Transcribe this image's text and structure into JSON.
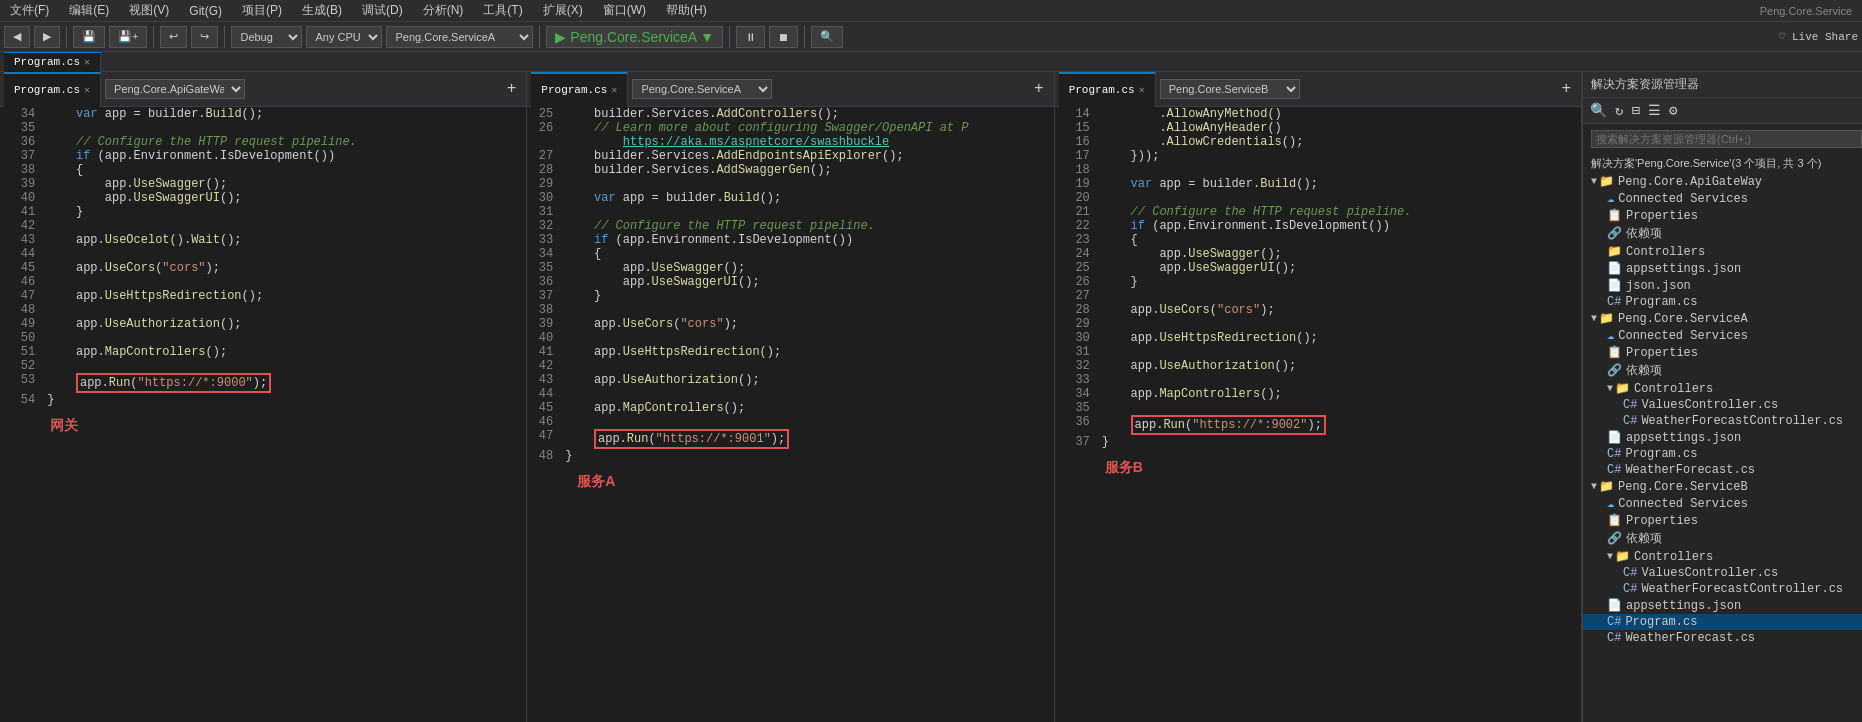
{
  "menubar": {
    "items": [
      "文件(F)",
      "编辑(E)",
      "视图(V)",
      "Git(G)",
      "项目(P)",
      "生成(B)",
      "调试(D)",
      "分析(N)",
      "工具(T)",
      "扩展(X)",
      "窗口(W)",
      "帮助(H)"
    ]
  },
  "toolbar": {
    "back_btn": "◀",
    "forward_btn": "▶",
    "debug_mode": "Debug",
    "platform": "Any CPU",
    "project": "Peng.Core.ServiceA",
    "play_label": "▶ Peng.Core.ServiceA ▼",
    "live_share": "♡ Live Share"
  },
  "top_tabs": [
    {
      "label": "Program.cs",
      "active": true,
      "closeable": true
    }
  ],
  "panels": [
    {
      "id": "panel1",
      "tab_label": "Program.cs",
      "dropdown_label": "Peng.Core.ApiGateWa...",
      "title": "网关",
      "lines": [
        {
          "num": 34,
          "code": "    var app = builder.Build();"
        },
        {
          "num": 35,
          "code": ""
        },
        {
          "num": 36,
          "code": "    // Configure the HTTP request pipeline."
        },
        {
          "num": 37,
          "code": "    if (app.Environment.IsDevelopment())"
        },
        {
          "num": 38,
          "code": "    {"
        },
        {
          "num": 39,
          "code": "        app.UseSwagger();"
        },
        {
          "num": 40,
          "code": "        app.UseSwaggerUI();"
        },
        {
          "num": 41,
          "code": "    }"
        },
        {
          "num": 42,
          "code": ""
        },
        {
          "num": 43,
          "code": "    app.UseOcelot().Wait();"
        },
        {
          "num": 44,
          "code": ""
        },
        {
          "num": 45,
          "code": "    app.UseCors(\"cors\");"
        },
        {
          "num": 46,
          "code": ""
        },
        {
          "num": 47,
          "code": "    app.UseHttpsRedirection();"
        },
        {
          "num": 48,
          "code": ""
        },
        {
          "num": 49,
          "code": "    app.UseAuthorization();"
        },
        {
          "num": 50,
          "code": ""
        },
        {
          "num": 51,
          "code": "    app.MapControllers();"
        },
        {
          "num": 52,
          "code": ""
        },
        {
          "num": 53,
          "code": "    app.Run(\"https://*:9000\");",
          "highlight": true
        },
        {
          "num": 54,
          "code": "}"
        }
      ]
    },
    {
      "id": "panel2",
      "tab_label": "Program.cs",
      "dropdown_label": "Peng.Core.ServiceA",
      "title": "服务A",
      "lines": [
        {
          "num": 25,
          "code": "    builder.Services.AddControllers();"
        },
        {
          "num": 26,
          "code": "    // Learn more about configuring Swagger/OpenAPI at P"
        },
        {
          "num": 27,
          "code": "        https://aka.ms/aspnetcore/swashbuckle",
          "is_link": true
        },
        {
          "num": 27,
          "code": "    builder.Services.AddEndpointsApiExplorer();"
        },
        {
          "num": 28,
          "code": "    builder.Services.AddSwaggerGen();"
        },
        {
          "num": 29,
          "code": ""
        },
        {
          "num": 30,
          "code": "    var app = builder.Build();"
        },
        {
          "num": 31,
          "code": ""
        },
        {
          "num": 32,
          "code": "    // Configure the HTTP request pipeline."
        },
        {
          "num": 33,
          "code": "    if (app.Environment.IsDevelopment())"
        },
        {
          "num": 34,
          "code": "    {"
        },
        {
          "num": 35,
          "code": "        app.UseSwagger();"
        },
        {
          "num": 36,
          "code": "        app.UseSwaggerUI();"
        },
        {
          "num": 37,
          "code": "    }"
        },
        {
          "num": 38,
          "code": ""
        },
        {
          "num": 39,
          "code": "    app.UseCors(\"cors\");"
        },
        {
          "num": 40,
          "code": ""
        },
        {
          "num": 41,
          "code": "    app.UseHttpsRedirection();"
        },
        {
          "num": 42,
          "code": ""
        },
        {
          "num": 43,
          "code": "    app.UseAuthorization();"
        },
        {
          "num": 44,
          "code": ""
        },
        {
          "num": 45,
          "code": "    app.MapControllers();"
        },
        {
          "num": 46,
          "code": ""
        },
        {
          "num": 47,
          "code": "    app.Run(\"https://*:9001\");",
          "highlight": true
        },
        {
          "num": 48,
          "code": "}"
        }
      ]
    },
    {
      "id": "panel3",
      "tab_label": "Program.cs",
      "dropdown_label": "Peng.Core.ServiceB",
      "title": "服务B",
      "lines": [
        {
          "num": 14,
          "code": "        .AllowAnyMethod()"
        },
        {
          "num": 15,
          "code": "        .AllowAnyHeader()"
        },
        {
          "num": 16,
          "code": "        .AllowCredentials();"
        },
        {
          "num": 17,
          "code": "    }));"
        },
        {
          "num": 18,
          "code": ""
        },
        {
          "num": 19,
          "code": "    var app = builder.Build();"
        },
        {
          "num": 20,
          "code": ""
        },
        {
          "num": 21,
          "code": "    // Configure the HTTP request pipeline."
        },
        {
          "num": 22,
          "code": "    if (app.Environment.IsDevelopment())"
        },
        {
          "num": 23,
          "code": "    {"
        },
        {
          "num": 24,
          "code": "        app.UseSwagger();"
        },
        {
          "num": 25,
          "code": "        app.UseSwaggerUI();"
        },
        {
          "num": 26,
          "code": "    }"
        },
        {
          "num": 27,
          "code": ""
        },
        {
          "num": 28,
          "code": "    app.UseCors(\"cors\");"
        },
        {
          "num": 29,
          "code": ""
        },
        {
          "num": 30,
          "code": "    app.UseHttpsRedirection();"
        },
        {
          "num": 31,
          "code": ""
        },
        {
          "num": 32,
          "code": "    app.UseAuthorization();"
        },
        {
          "num": 33,
          "code": ""
        },
        {
          "num": 34,
          "code": "    app.MapControllers();"
        },
        {
          "num": 35,
          "code": ""
        },
        {
          "num": 36,
          "code": "    app.Run(\"https://*:9002\");",
          "highlight": true
        },
        {
          "num": 37,
          "code": "}"
        }
      ]
    }
  ],
  "sidebar": {
    "title": "解决方案资源管理器",
    "search_placeholder": "搜索解决方案资源管理器(Ctrl+;)",
    "solution_label": "解决方案'Peng.Core.Service'(3 个项目, 共 3 个)",
    "tree": [
      {
        "indent": 0,
        "icon": "📁",
        "label": "Peng.Core.ApiGateWay",
        "expanded": true,
        "type": "project"
      },
      {
        "indent": 1,
        "icon": "☁",
        "label": "Connected Services",
        "type": "connected"
      },
      {
        "indent": 1,
        "icon": "📋",
        "label": "Properties",
        "type": "props"
      },
      {
        "indent": 1,
        "icon": "🔗",
        "label": "依赖项",
        "type": "deps"
      },
      {
        "indent": 1,
        "icon": "📁",
        "label": "Controllers",
        "type": "folder"
      },
      {
        "indent": 1,
        "icon": "📄",
        "label": "appsettings.json",
        "type": "json"
      },
      {
        "indent": 1,
        "icon": "📄",
        "label": "json.json",
        "type": "json"
      },
      {
        "indent": 1,
        "icon": "🔷",
        "label": "Program.cs",
        "type": "cs"
      },
      {
        "indent": 0,
        "icon": "📁",
        "label": "Peng.Core.ServiceA",
        "expanded": true,
        "type": "project"
      },
      {
        "indent": 1,
        "icon": "☁",
        "label": "Connected Services",
        "type": "connected"
      },
      {
        "indent": 1,
        "icon": "📋",
        "label": "Properties",
        "type": "props"
      },
      {
        "indent": 1,
        "icon": "🔗",
        "label": "依赖项",
        "type": "deps"
      },
      {
        "indent": 1,
        "icon": "📁",
        "label": "Controllers",
        "type": "folder",
        "expanded": true
      },
      {
        "indent": 2,
        "icon": "🔷",
        "label": "ValuesController.cs",
        "type": "cs"
      },
      {
        "indent": 2,
        "icon": "🔷",
        "label": "WeatherForecastController.cs",
        "type": "cs"
      },
      {
        "indent": 1,
        "icon": "📄",
        "label": "appsettings.json",
        "type": "json"
      },
      {
        "indent": 1,
        "icon": "🔷",
        "label": "Program.cs",
        "type": "cs"
      },
      {
        "indent": 1,
        "icon": "🔷",
        "label": "WeatherForecast.cs",
        "type": "cs"
      },
      {
        "indent": 0,
        "icon": "📁",
        "label": "Peng.Core.ServiceB",
        "expanded": true,
        "type": "project"
      },
      {
        "indent": 1,
        "icon": "☁",
        "label": "Connected Services",
        "type": "connected"
      },
      {
        "indent": 1,
        "icon": "📋",
        "label": "Properties",
        "type": "props"
      },
      {
        "indent": 1,
        "icon": "🔗",
        "label": "依赖项",
        "type": "deps"
      },
      {
        "indent": 1,
        "icon": "📁",
        "label": "Controllers",
        "type": "folder",
        "expanded": true
      },
      {
        "indent": 2,
        "icon": "🔷",
        "label": "ValuesController.cs",
        "type": "cs"
      },
      {
        "indent": 2,
        "icon": "🔷",
        "label": "WeatherForecastController.cs",
        "type": "cs"
      },
      {
        "indent": 1,
        "icon": "📄",
        "label": "appsettings.json",
        "type": "json"
      },
      {
        "indent": 1,
        "icon": "🔷",
        "label": "Program.cs",
        "type": "cs",
        "selected": true
      },
      {
        "indent": 1,
        "icon": "🔷",
        "label": "WeatherForecast.cs",
        "type": "cs"
      }
    ]
  }
}
